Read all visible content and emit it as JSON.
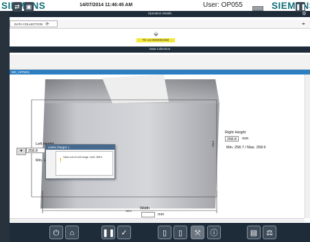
{
  "header": {
    "brand_left": "SIEMENS",
    "brand_right": "SIEMENS",
    "datetime": "14/07/2014  11:46:45 AM",
    "user": "User: OP055",
    "operation_title": "Operation Details"
  },
  "tabs": [
    {
      "label": "DATA COLLECTION"
    }
  ],
  "part": {
    "tk_code": "TK-14-0000001050"
  },
  "data_collection": {
    "title": "Data Collection"
  },
  "toolbar": {
    "refresh_icon": "refresh-icon",
    "save_icon": "save-icon",
    "pause_icon": "pause-icon"
  },
  "canvas": {
    "header_label": "MC_HITNO1"
  },
  "measurements": {
    "left_height_label": "Left Height",
    "left_height_value": "258.8",
    "left_height_range": "Min. 258.9",
    "left_button": "▼",
    "right_height_label": "Right Height",
    "right_height_value": "258.8",
    "right_unit": "mm",
    "right_height_range": "Min. 258.7 / Max. 258.9",
    "width_label": "Width",
    "width_value": "",
    "width_unit": "mm",
    "width_dim": "465.5",
    "right_dim": "258.8"
  },
  "popup": {
    "title": "Limits (Target: )",
    "message": "Value out of Limit range. Limit: 258.9"
  },
  "bottom_toolbar": [
    {
      "icon": "power-icon"
    },
    {
      "icon": "home-icon"
    },
    {
      "icon": "pause-icon"
    },
    {
      "icon": "check-icon"
    },
    {
      "icon": "document-icon"
    },
    {
      "icon": "copy-icon"
    },
    {
      "icon": "hammer-icon"
    },
    {
      "icon": "info-icon"
    },
    {
      "icon": "pdf-icon"
    },
    {
      "icon": "balance-icon"
    }
  ],
  "colors": {
    "brand": "#0f6f7a",
    "dark_bar": "#1e2b39",
    "accent_blue": "#2e7fc2",
    "tk_highlight": "#f5e63a"
  }
}
